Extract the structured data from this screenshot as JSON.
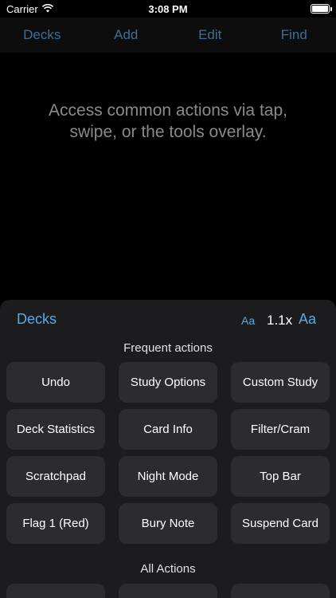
{
  "status": {
    "carrier": "Carrier",
    "time": "3:08 PM",
    "wifi_icon": "wifi-icon",
    "battery_level": 1.0
  },
  "nav": {
    "decks": "Decks",
    "add": "Add",
    "edit": "Edit",
    "find": "Find"
  },
  "hint": "Access common actions via tap, swipe, or the tools overlay.",
  "overlay": {
    "decks_label": "Decks",
    "font_small": "Aa",
    "zoom": "1.1x",
    "font_large": "Aa",
    "frequent_title": "Frequent actions",
    "all_title": "All Actions",
    "actions": [
      "Undo",
      "Study Options",
      "Custom Study",
      "Deck Statistics",
      "Card Info",
      "Filter/Cram",
      "Scratchpad",
      "Night Mode",
      "Top Bar",
      "Flag 1 (Red)",
      "Bury Note",
      "Suspend Card"
    ]
  },
  "colors": {
    "accent": "#5aa9e6",
    "nav_link": "#3a6f99",
    "button_bg": "#2c2c2e",
    "panel_bg": "#1c1c1e"
  }
}
